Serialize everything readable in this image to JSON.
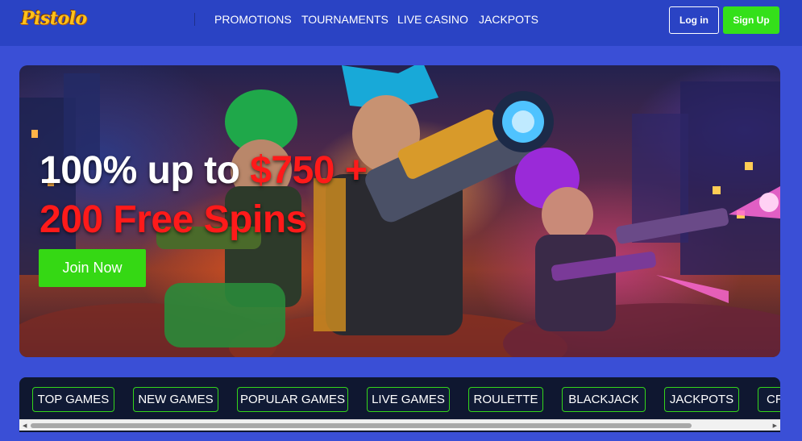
{
  "header": {
    "logo_text": "Pistolo",
    "nav": [
      {
        "label": "PROMOTIONS"
      },
      {
        "label": "TOURNAMENTS"
      },
      {
        "label": "LIVE CASINO"
      },
      {
        "label": "JACKPOTS"
      }
    ],
    "login_label": "Log in",
    "signup_label": "Sign Up"
  },
  "banner": {
    "line1_white": "100% up to ",
    "line1_red": "$750 +",
    "line2_red": "200 Free Spins",
    "cta_label": "Join Now"
  },
  "categories": [
    {
      "label": "TOP GAMES"
    },
    {
      "label": "NEW GAMES"
    },
    {
      "label": "POPULAR GAMES"
    },
    {
      "label": "LIVE GAMES"
    },
    {
      "label": "ROULETTE"
    },
    {
      "label": "BLACKJACK"
    },
    {
      "label": "JACKPOTS"
    },
    {
      "label": "CR"
    }
  ],
  "colors": {
    "page_bg": "#3a4fd6",
    "header_bg": "#2a43c4",
    "accent_green": "#34e01a",
    "headline_red": "#ff1a1a",
    "catbar_bg": "#0f1730"
  },
  "icons": {
    "scroll_left": "triangle-left-icon",
    "scroll_right": "triangle-right-icon"
  }
}
